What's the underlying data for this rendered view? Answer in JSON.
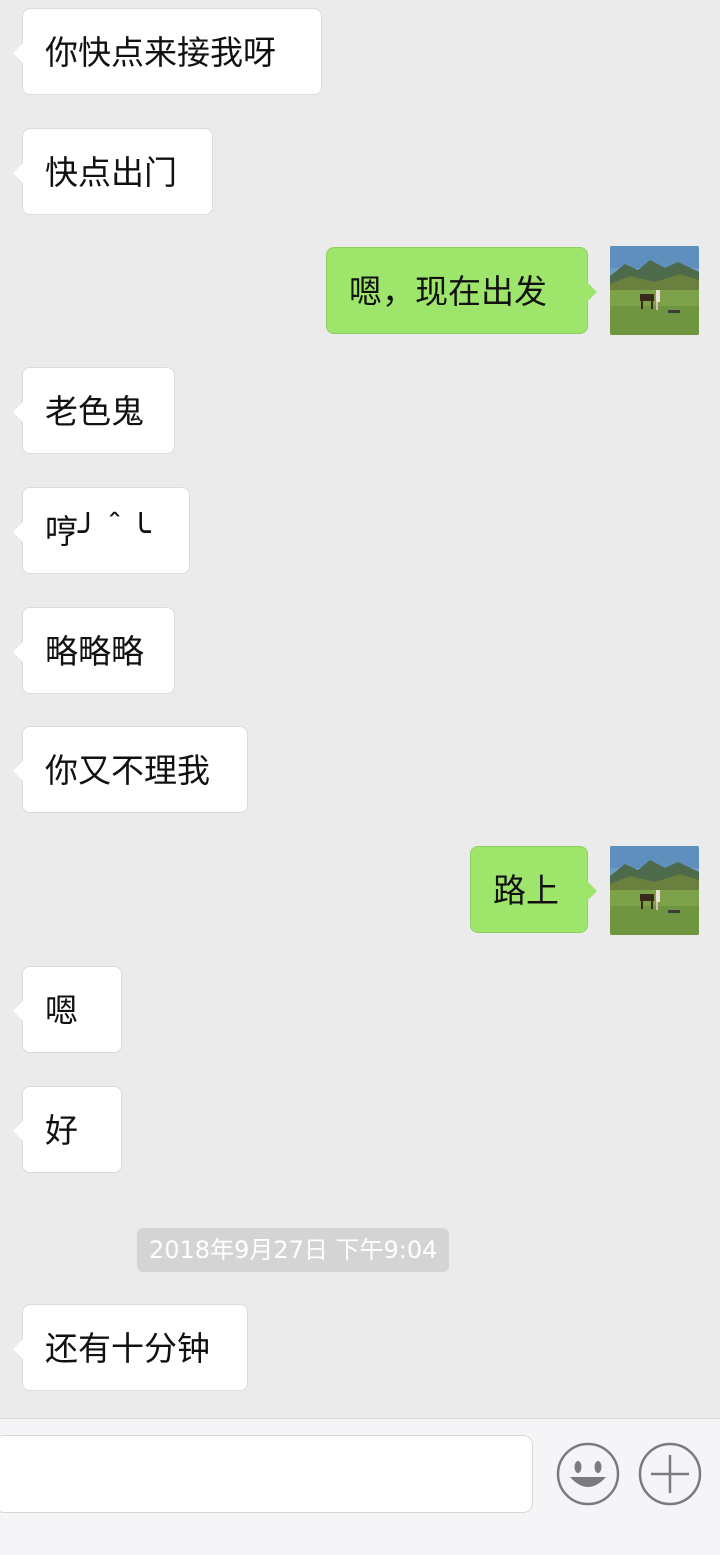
{
  "messages": [
    {
      "side": "left",
      "text": "你快点来接我呀"
    },
    {
      "side": "left",
      "text": "快点出门"
    },
    {
      "side": "right",
      "text": "嗯，现在出发"
    },
    {
      "side": "left",
      "text": "老色鬼"
    },
    {
      "side": "left",
      "text": "哼╯＾╰"
    },
    {
      "side": "left",
      "text": "略略略"
    },
    {
      "side": "left",
      "text": "你又不理我"
    },
    {
      "side": "right",
      "text": "路上"
    },
    {
      "side": "left",
      "text": "嗯"
    },
    {
      "side": "left",
      "text": "好"
    },
    {
      "side": "left",
      "text": "还有十分钟"
    }
  ],
  "timestamp": "2018年9月27日 下午9:04",
  "input_bar": {
    "text_value": "",
    "emoji_icon": "smiley-face-icon",
    "more_icon": "plus-circle-icon"
  },
  "colors": {
    "background": "#ebebeb",
    "left_bubble": "#ffffff",
    "right_bubble": "#9ee66b",
    "timestamp_bg": "#d4d4d4"
  }
}
